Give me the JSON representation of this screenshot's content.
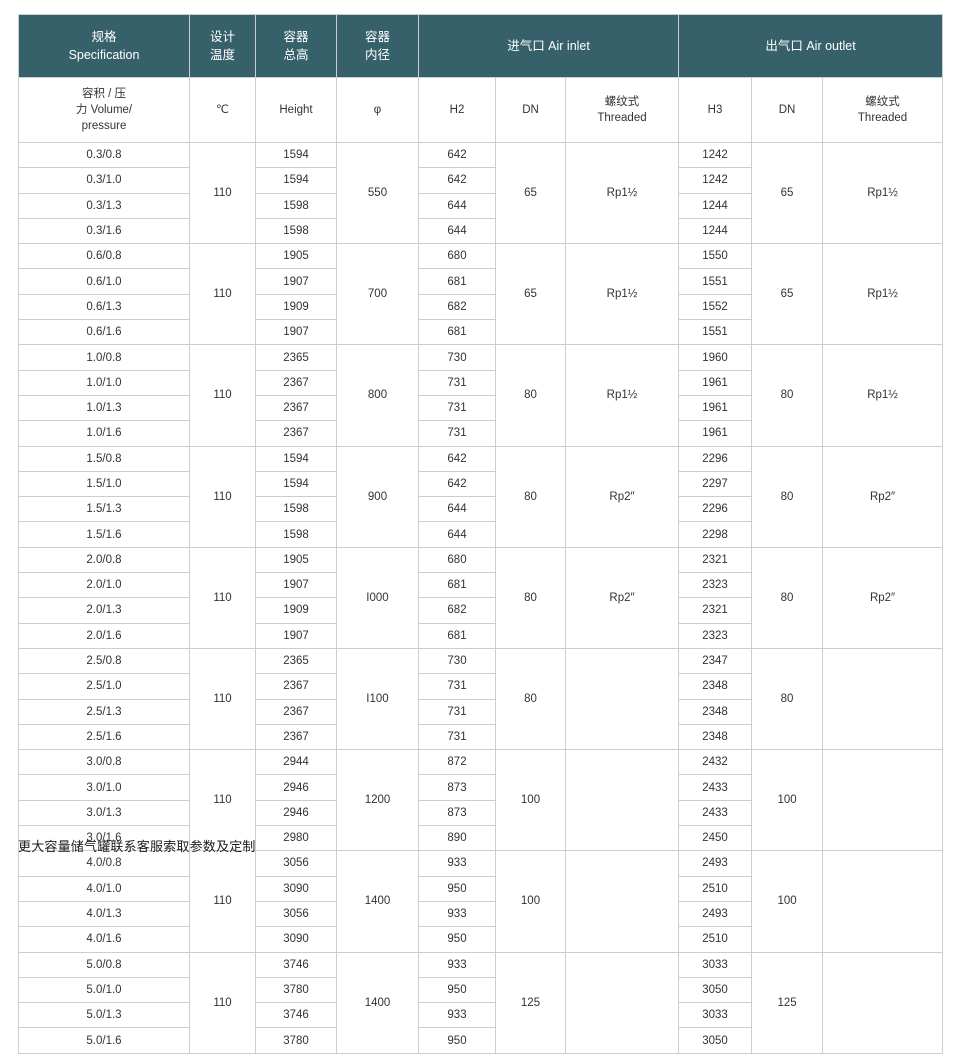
{
  "table": {
    "header": {
      "specification": {
        "cn": "规格",
        "en": "Specification"
      },
      "design_temperature": {
        "cn": "设计",
        "cn2": "温度"
      },
      "vessel_total_height": {
        "cn": "容器",
        "cn2": "总高"
      },
      "vessel_inner_diameter": {
        "cn": "容器",
        "cn2": "内径"
      },
      "air_inlet": "进气口 Air inlet",
      "air_outlet": "出气口 Air outlet"
    },
    "units": {
      "specification": {
        "line1": "容积 / 压",
        "line2": "力 Volume/",
        "line3": "pressure"
      },
      "temperature": "℃",
      "height": "Height",
      "phi": "φ",
      "inlet_h": "H2",
      "inlet_dn": "DN",
      "inlet_threaded": {
        "cn": "螺纹式",
        "en": "Threaded"
      },
      "outlet_h": "H3",
      "outlet_dn": "DN",
      "outlet_threaded": {
        "cn": "螺纹式",
        "en": "Threaded"
      }
    },
    "groups": [
      {
        "temperature": "110",
        "diameter": "550",
        "inlet_dn": "65",
        "inlet_threaded": "Rp1½",
        "outlet_dn": "65",
        "outlet_threaded": "Rp1½",
        "rows": [
          {
            "spec": "0.3/0.8",
            "height": "1594",
            "h2": "642",
            "h3": "1242"
          },
          {
            "spec": "0.3/1.0",
            "height": "1594",
            "h2": "642",
            "h3": "1242"
          },
          {
            "spec": "0.3/1.3",
            "height": "1598",
            "h2": "644",
            "h3": "1244"
          },
          {
            "spec": "0.3/1.6",
            "height": "1598",
            "h2": "644",
            "h3": "1244"
          }
        ]
      },
      {
        "temperature": "110",
        "diameter": "700",
        "inlet_dn": "65",
        "inlet_threaded": "Rp1½",
        "outlet_dn": "65",
        "outlet_threaded": "Rp1½",
        "rows": [
          {
            "spec": "0.6/0.8",
            "height": "1905",
            "h2": "680",
            "h3": "1550"
          },
          {
            "spec": "0.6/1.0",
            "height": "1907",
            "h2": "681",
            "h3": "1551"
          },
          {
            "spec": "0.6/1.3",
            "height": "1909",
            "h2": "682",
            "h3": "1552"
          },
          {
            "spec": "0.6/1.6",
            "height": "1907",
            "h2": "681",
            "h3": "1551"
          }
        ]
      },
      {
        "temperature": "110",
        "diameter": "800",
        "inlet_dn": "80",
        "inlet_threaded": "Rp1½",
        "outlet_dn": "80",
        "outlet_threaded": "Rp1½",
        "rows": [
          {
            "spec": "1.0/0.8",
            "height": "2365",
            "h2": "730",
            "h3": "1960"
          },
          {
            "spec": "1.0/1.0",
            "height": "2367",
            "h2": "731",
            "h3": "1961"
          },
          {
            "spec": "1.0/1.3",
            "height": "2367",
            "h2": "731",
            "h3": "1961"
          },
          {
            "spec": "1.0/1.6",
            "height": "2367",
            "h2": "731",
            "h3": "1961"
          }
        ]
      },
      {
        "temperature": "110",
        "diameter": "900",
        "inlet_dn": "80",
        "inlet_threaded": "Rp2″",
        "outlet_dn": "80",
        "outlet_threaded": "Rp2″",
        "rows": [
          {
            "spec": "1.5/0.8",
            "height": "1594",
            "h2": "642",
            "h3": "2296"
          },
          {
            "spec": "1.5/1.0",
            "height": "1594",
            "h2": "642",
            "h3": "2297"
          },
          {
            "spec": "1.5/1.3",
            "height": "1598",
            "h2": "644",
            "h3": "2296"
          },
          {
            "spec": "1.5/1.6",
            "height": "1598",
            "h2": "644",
            "h3": "2298"
          }
        ]
      },
      {
        "temperature": "110",
        "diameter": "I000",
        "inlet_dn": "80",
        "inlet_threaded": "Rp2″",
        "outlet_dn": "80",
        "outlet_threaded": "Rp2″",
        "rows": [
          {
            "spec": "2.0/0.8",
            "height": "1905",
            "h2": "680",
            "h3": "2321"
          },
          {
            "spec": "2.0/1.0",
            "height": "1907",
            "h2": "681",
            "h3": "2323"
          },
          {
            "spec": "2.0/1.3",
            "height": "1909",
            "h2": "682",
            "h3": "2321"
          },
          {
            "spec": "2.0/1.6",
            "height": "1907",
            "h2": "681",
            "h3": "2323"
          }
        ]
      },
      {
        "temperature": "110",
        "diameter": "I100",
        "inlet_dn": "80",
        "inlet_threaded": "",
        "outlet_dn": "80",
        "outlet_threaded": "",
        "rows": [
          {
            "spec": "2.5/0.8",
            "height": "2365",
            "h2": "730",
            "h3": "2347"
          },
          {
            "spec": "2.5/1.0",
            "height": "2367",
            "h2": "731",
            "h3": "2348"
          },
          {
            "spec": "2.5/1.3",
            "height": "2367",
            "h2": "731",
            "h3": "2348"
          },
          {
            "spec": "2.5/1.6",
            "height": "2367",
            "h2": "731",
            "h3": "2348"
          }
        ]
      },
      {
        "temperature": "110",
        "diameter": "1200",
        "inlet_dn": "100",
        "inlet_threaded": "",
        "outlet_dn": "100",
        "outlet_threaded": "",
        "rows": [
          {
            "spec": "3.0/0.8",
            "height": "2944",
            "h2": "872",
            "h3": "2432"
          },
          {
            "spec": "3.0/1.0",
            "height": "2946",
            "h2": "873",
            "h3": "2433"
          },
          {
            "spec": "3.0/1.3",
            "height": "2946",
            "h2": "873",
            "h3": "2433"
          },
          {
            "spec": "3.0/1.6",
            "height": "2980",
            "h2": "890",
            "h3": "2450"
          }
        ]
      },
      {
        "temperature": "110",
        "diameter": "1400",
        "inlet_dn": "100",
        "inlet_threaded": "",
        "outlet_dn": "100",
        "outlet_threaded": "",
        "rows": [
          {
            "spec": "4.0/0.8",
            "height": "3056",
            "h2": "933",
            "h3": "2493"
          },
          {
            "spec": "4.0/1.0",
            "height": "3090",
            "h2": "950",
            "h3": "2510"
          },
          {
            "spec": "4.0/1.3",
            "height": "3056",
            "h2": "933",
            "h3": "2493"
          },
          {
            "spec": "4.0/1.6",
            "height": "3090",
            "h2": "950",
            "h3": "2510"
          }
        ]
      },
      {
        "temperature": "110",
        "diameter": "1400",
        "inlet_dn": "125",
        "inlet_threaded": "",
        "outlet_dn": "125",
        "outlet_threaded": "",
        "rows": [
          {
            "spec": "5.0/0.8",
            "height": "3746",
            "h2": "933",
            "h3": "3033"
          },
          {
            "spec": "5.0/1.0",
            "height": "3780",
            "h2": "950",
            "h3": "3050"
          },
          {
            "spec": "5.0/1.3",
            "height": "3746",
            "h2": "933",
            "h3": "3033"
          },
          {
            "spec": "5.0/1.6",
            "height": "3780",
            "h2": "950",
            "h3": "3050"
          }
        ]
      }
    ]
  },
  "footer_note": "更大容量储气罐联系客服索取参数及定制",
  "colors": {
    "header_background": "#36606a",
    "header_text": "#ffffff",
    "grid_line": "#c9ced1",
    "body_text": "#333333"
  }
}
